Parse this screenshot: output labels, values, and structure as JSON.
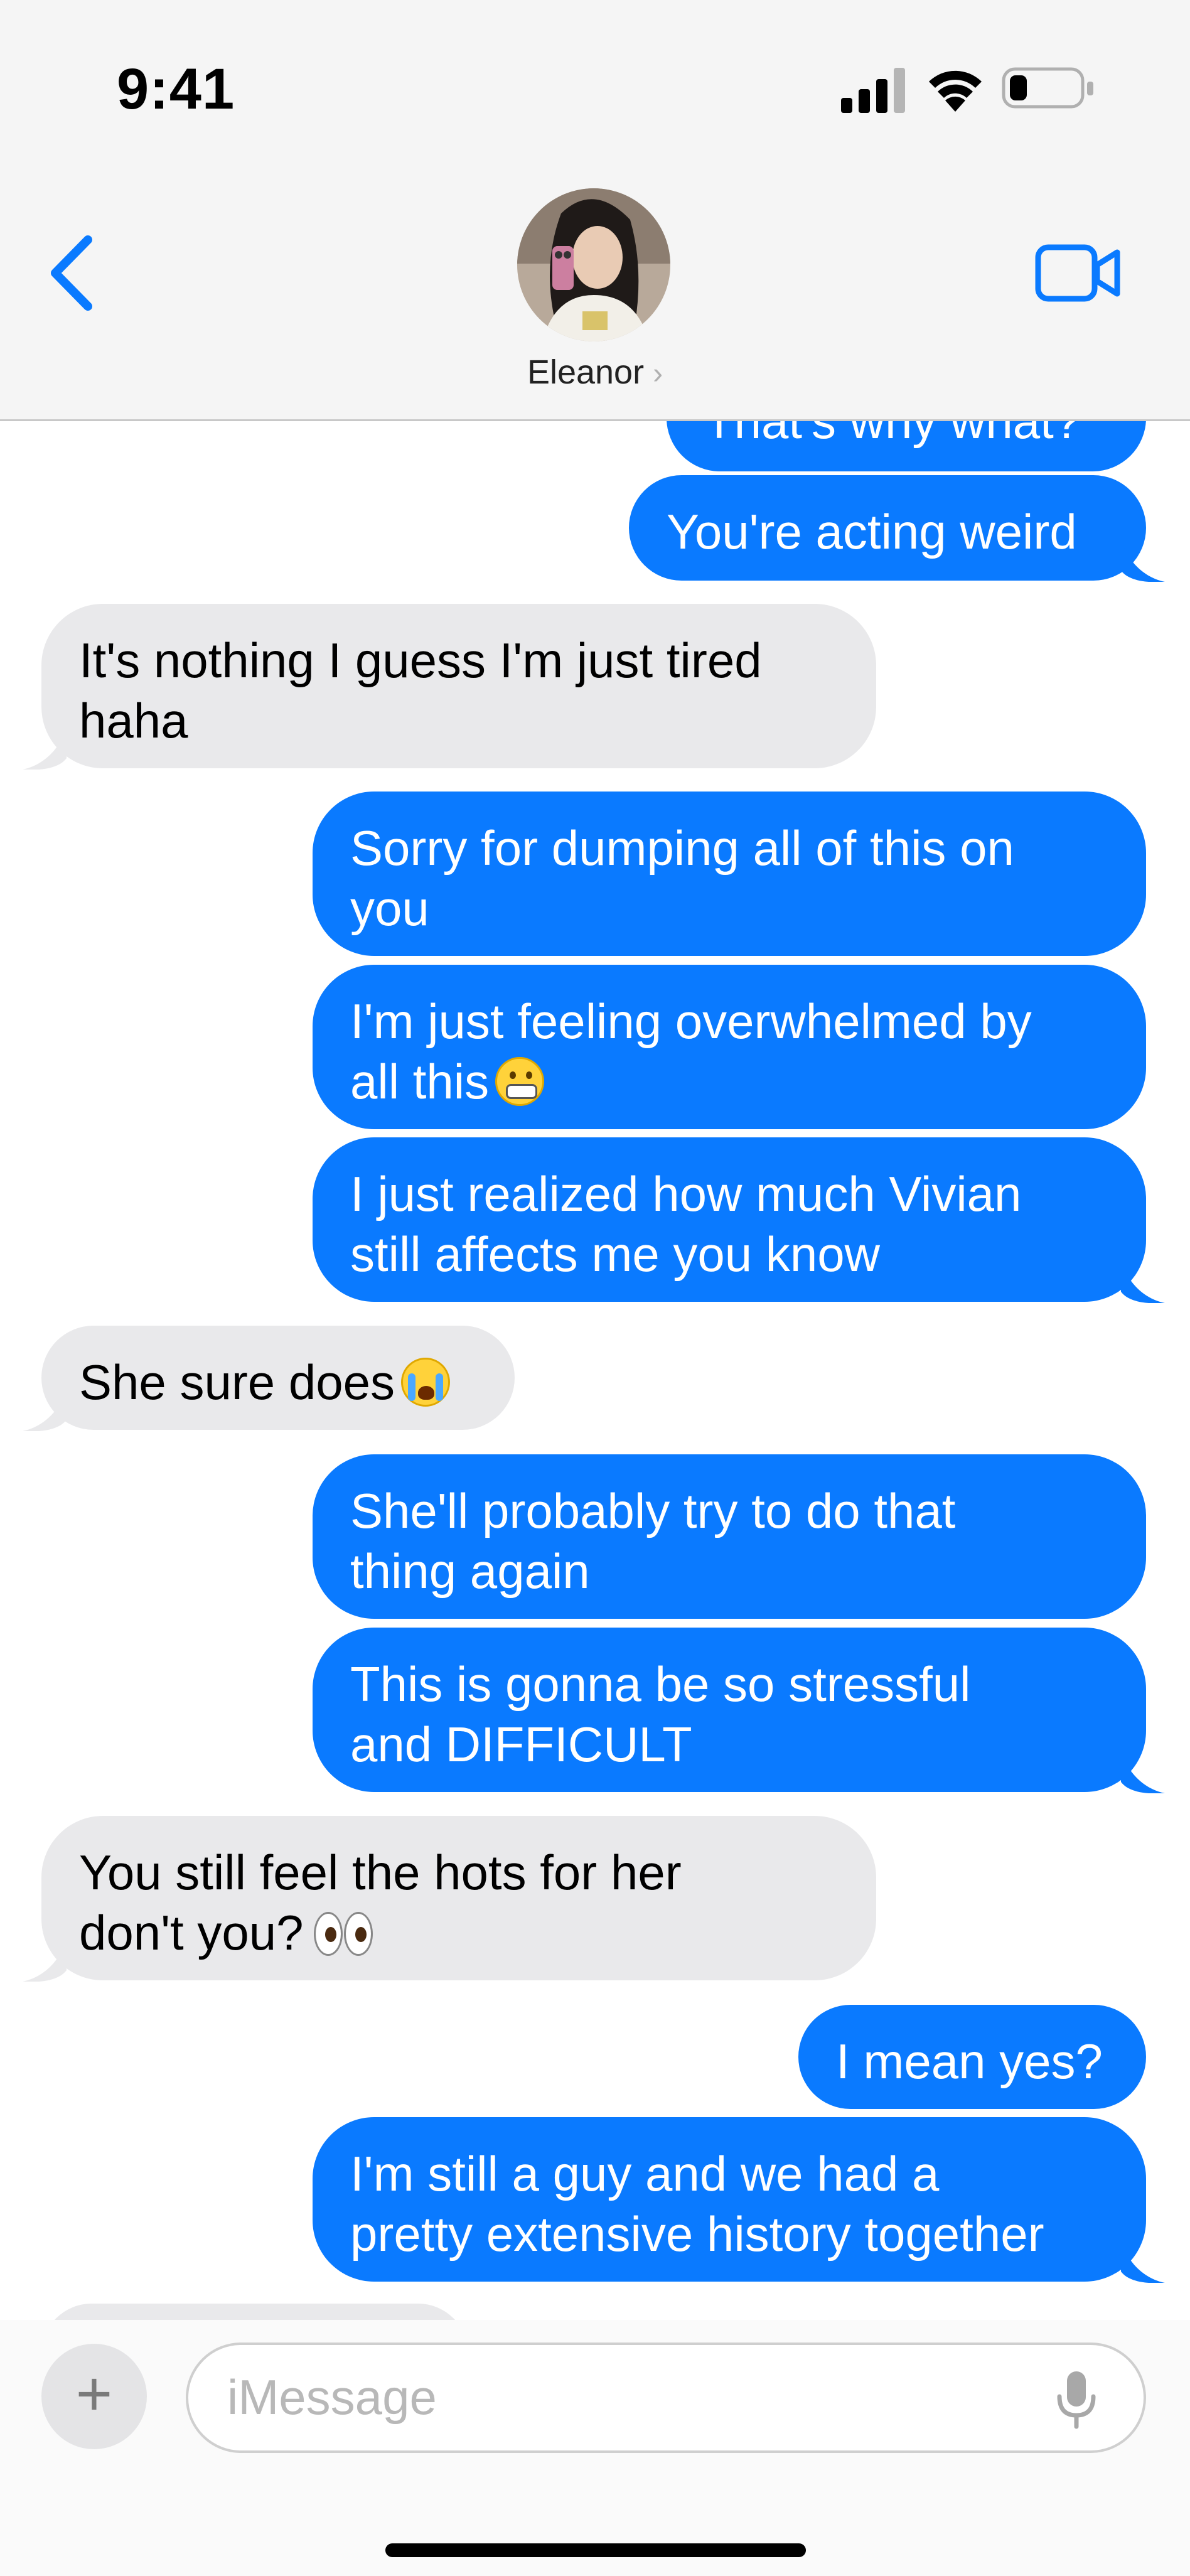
{
  "status_bar": {
    "time": "9:41",
    "icons": [
      "cellular-signal-icon",
      "wifi-icon",
      "battery-icon"
    ],
    "battery_level": 0.25
  },
  "header": {
    "contact_name": "Eleanor",
    "contact_chevron": "›",
    "icons": [
      "back-chevron-icon",
      "facetime-video-icon"
    ]
  },
  "colors": {
    "outgoing_bubble": "#0a7aff",
    "incoming_bubble": "#e9e9eb",
    "accent": "#0a7aff"
  },
  "messages": [
    {
      "from": "me",
      "lines": [
        "That's why what?"
      ]
    },
    {
      "from": "me",
      "lines": [
        "You're acting weird"
      ]
    },
    {
      "from": "them",
      "lines": [
        "It's nothing I guess I'm just tired",
        "haha"
      ]
    },
    {
      "from": "me",
      "lines": [
        "Sorry for dumping all of this on",
        "you"
      ]
    },
    {
      "from": "me",
      "lines": [
        "I'm just feeling overwhelmed by",
        "all this"
      ],
      "emoji": "grimacing-face-emoji"
    },
    {
      "from": "me",
      "lines": [
        "I just realized how much Vivian",
        "still affects me you know"
      ]
    },
    {
      "from": "them",
      "lines": [
        "She sure does"
      ],
      "emoji": "loudly-crying-face-emoji"
    },
    {
      "from": "me",
      "lines": [
        "She'll probably try to do that",
        "thing again"
      ]
    },
    {
      "from": "me",
      "lines": [
        "This is gonna be so stressful",
        "and DIFFICULT"
      ]
    },
    {
      "from": "them",
      "lines": [
        "You still feel the hots for her",
        "don't you?"
      ],
      "emoji": "eyes-emoji"
    },
    {
      "from": "me",
      "lines": [
        "I mean yes?"
      ]
    },
    {
      "from": "me",
      "lines": [
        "I'm still a guy and we had a",
        "pretty extensive history together"
      ]
    }
  ],
  "input": {
    "placeholder": "iMessage",
    "plus_label": "+",
    "icons": [
      "plus-icon",
      "microphone-icon"
    ]
  }
}
